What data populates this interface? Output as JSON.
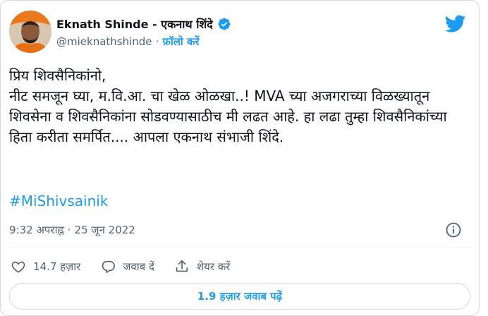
{
  "author": {
    "display_name": "Eknath Shinde - एकनाथ शिंदे",
    "handle": "@mieknathshinde",
    "separator": "·",
    "follow_label": "फ़ॉलो करें"
  },
  "tweet": {
    "text": "प्रिय शिवसैनिकांनो,\nनीट समजून घ्या, म.वि.आ. चा खेळ ओळखा..! MVA च्या अजगराच्या विळख्यातून शिवसेना व शिवसैनिकांना सोडवण्यासाठीच मी लढत आहे. हा लढा तुम्हा शिवसैनिकांच्या हिता करीता समर्पित.... आपला एकनाथ संभाजी शिंदे.",
    "hashtag": "#MiShivsainik",
    "time": "9:32 अपराह्न",
    "date_separator": "·",
    "date": "25 जून 2022"
  },
  "actions": {
    "likes_count": "14.7 हज़ार",
    "reply_label": "जवाब दें",
    "share_label": "शेयर करें"
  },
  "replies_button_label": "1.9 हज़ार जवाब पढ़ें",
  "icons": {
    "verified": "verified-badge-icon",
    "twitter": "twitter-bird-icon",
    "info": "info-icon",
    "like": "heart-icon",
    "reply": "reply-bubble-icon",
    "share": "share-upload-icon"
  },
  "colors": {
    "accent": "#1d9bf0",
    "text": "#0f1419",
    "muted": "#536471",
    "border": "#cfd9de"
  }
}
